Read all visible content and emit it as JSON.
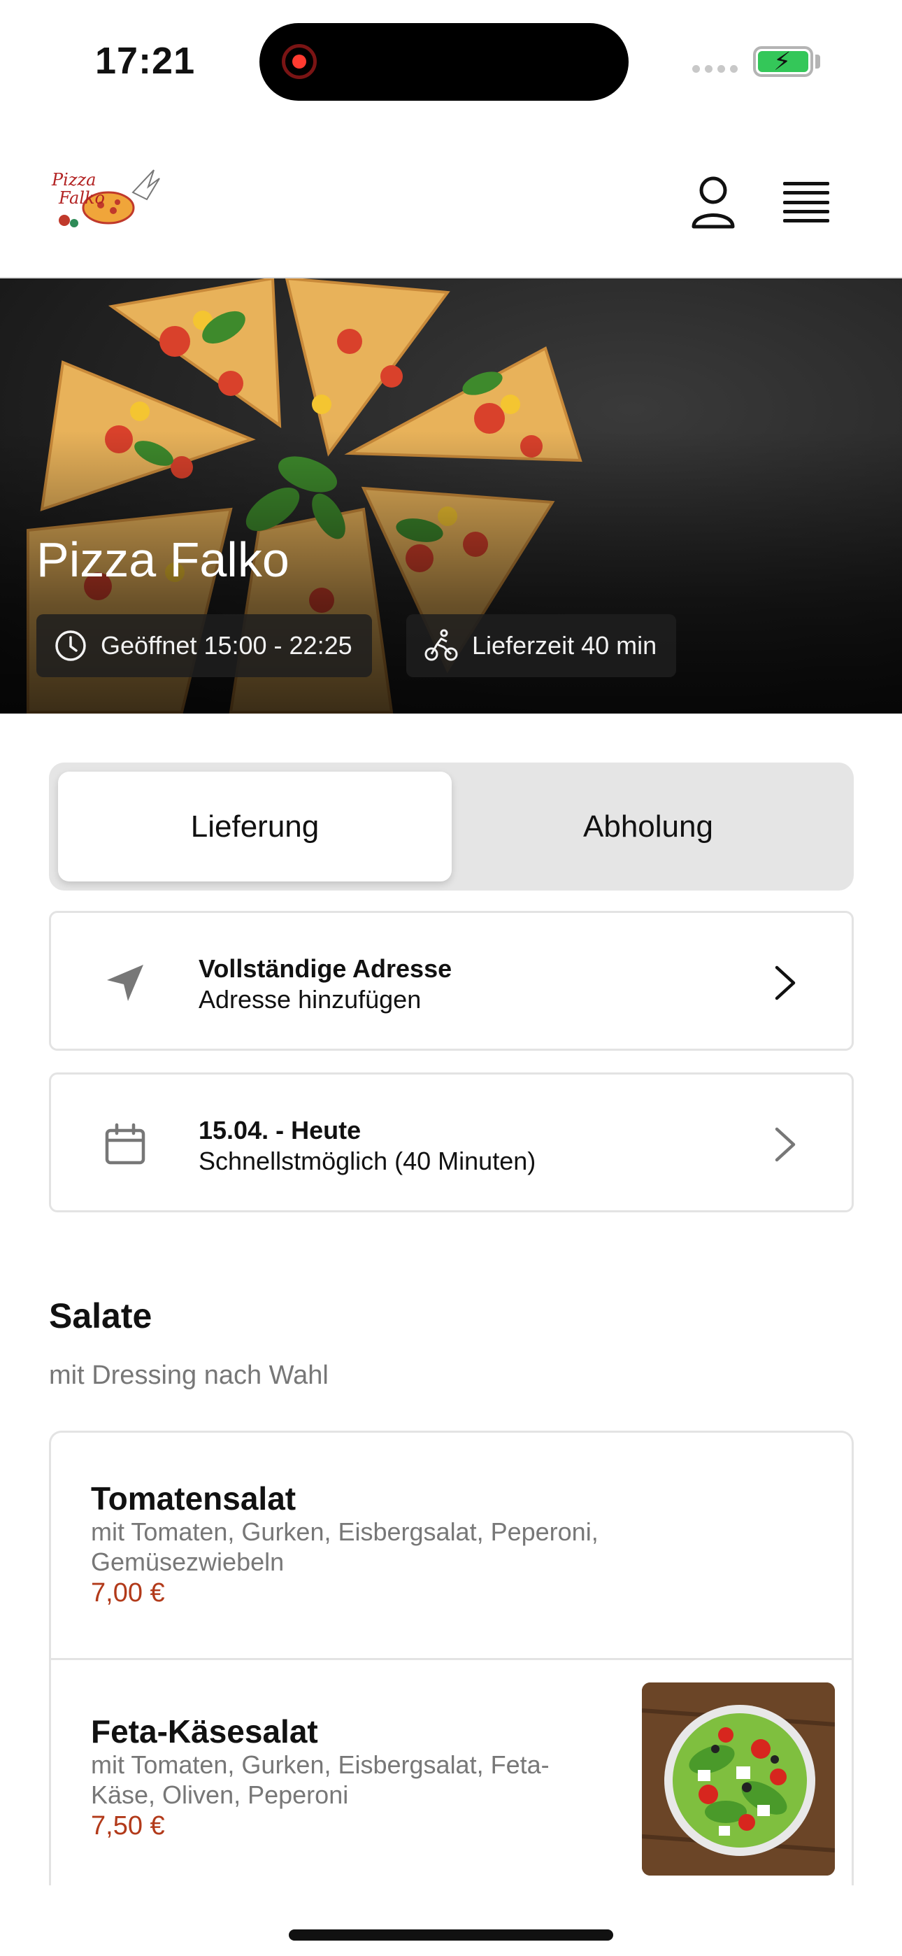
{
  "status_bar": {
    "time": "17:21"
  },
  "header": {
    "logo_text": "Pizza Falko",
    "icons": [
      "user-icon",
      "menu-icon"
    ]
  },
  "hero": {
    "title": "Pizza Falko",
    "opening_hours": "Geöffnet 15:00 - 22:25",
    "delivery_time": "Lieferzeit 40 min"
  },
  "order_type": {
    "options": [
      "Lieferung",
      "Abholung"
    ],
    "selected": "Lieferung"
  },
  "address": {
    "title": "Vollständige Adresse",
    "subtitle": "Adresse hinzufügen"
  },
  "schedule": {
    "title": "15.04. - Heute",
    "subtitle": "Schnellstmöglich (40 Minuten)"
  },
  "section": {
    "title": "Salate",
    "subtitle": "mit Dressing nach Wahl",
    "items": [
      {
        "name": "Tomatensalat",
        "desc_line1": "mit Tomaten, Gurken, Eisbergsalat, Peperoni,",
        "desc_line2": "Gemüsezwiebeln",
        "price": "7,00 €"
      },
      {
        "name": "Feta-Käsesalat",
        "desc_line1": "mit Tomaten, Gurken, Eisbergsalat, Feta-",
        "desc_line2": "Käse, Oliven, Peperoni",
        "price": "7,50 €"
      }
    ]
  },
  "colors": {
    "price": "#b23a1a",
    "toggle_bg": "#e5e5e5",
    "battery": "#34c759"
  }
}
